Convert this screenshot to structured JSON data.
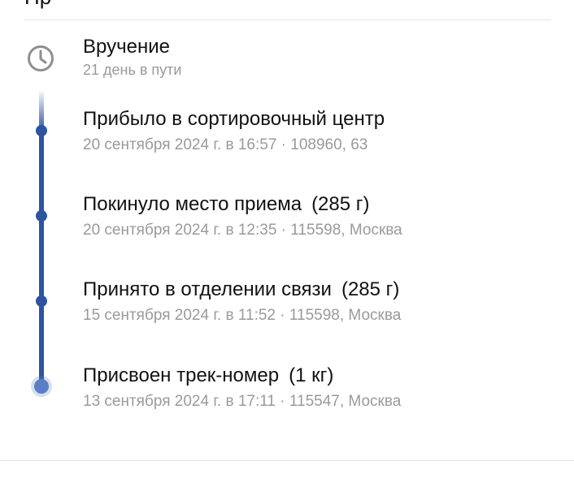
{
  "header": {
    "cut_text": "Пр"
  },
  "status": {
    "title": "Вручение",
    "subtitle": "21 день в пути",
    "icon": "clock-icon"
  },
  "events": [
    {
      "title": "Прибыло в сортировочный центр",
      "weight": "",
      "details": "20 сентября 2024 г. в 16:57 · 108960, 63"
    },
    {
      "title": "Покинуло место приема",
      "weight": "(285 г)",
      "details": "20 сентября 2024 г. в 12:35 · 115598, Москва"
    },
    {
      "title": "Принято в отделении связи",
      "weight": "(285 г)",
      "details": "15 сентября 2024 г. в 11:52 · 115598, Москва"
    },
    {
      "title": "Присвоен трек-номер",
      "weight": "(1 кг)",
      "details": "13 сентября 2024 г. в 17:11 · 115547, Москва"
    }
  ],
  "colors": {
    "timeline": "#2d54a0",
    "timeline_last": "#5a7fc6",
    "secondary_text": "#9a9a9a",
    "icon_gray": "#8e8e93"
  }
}
